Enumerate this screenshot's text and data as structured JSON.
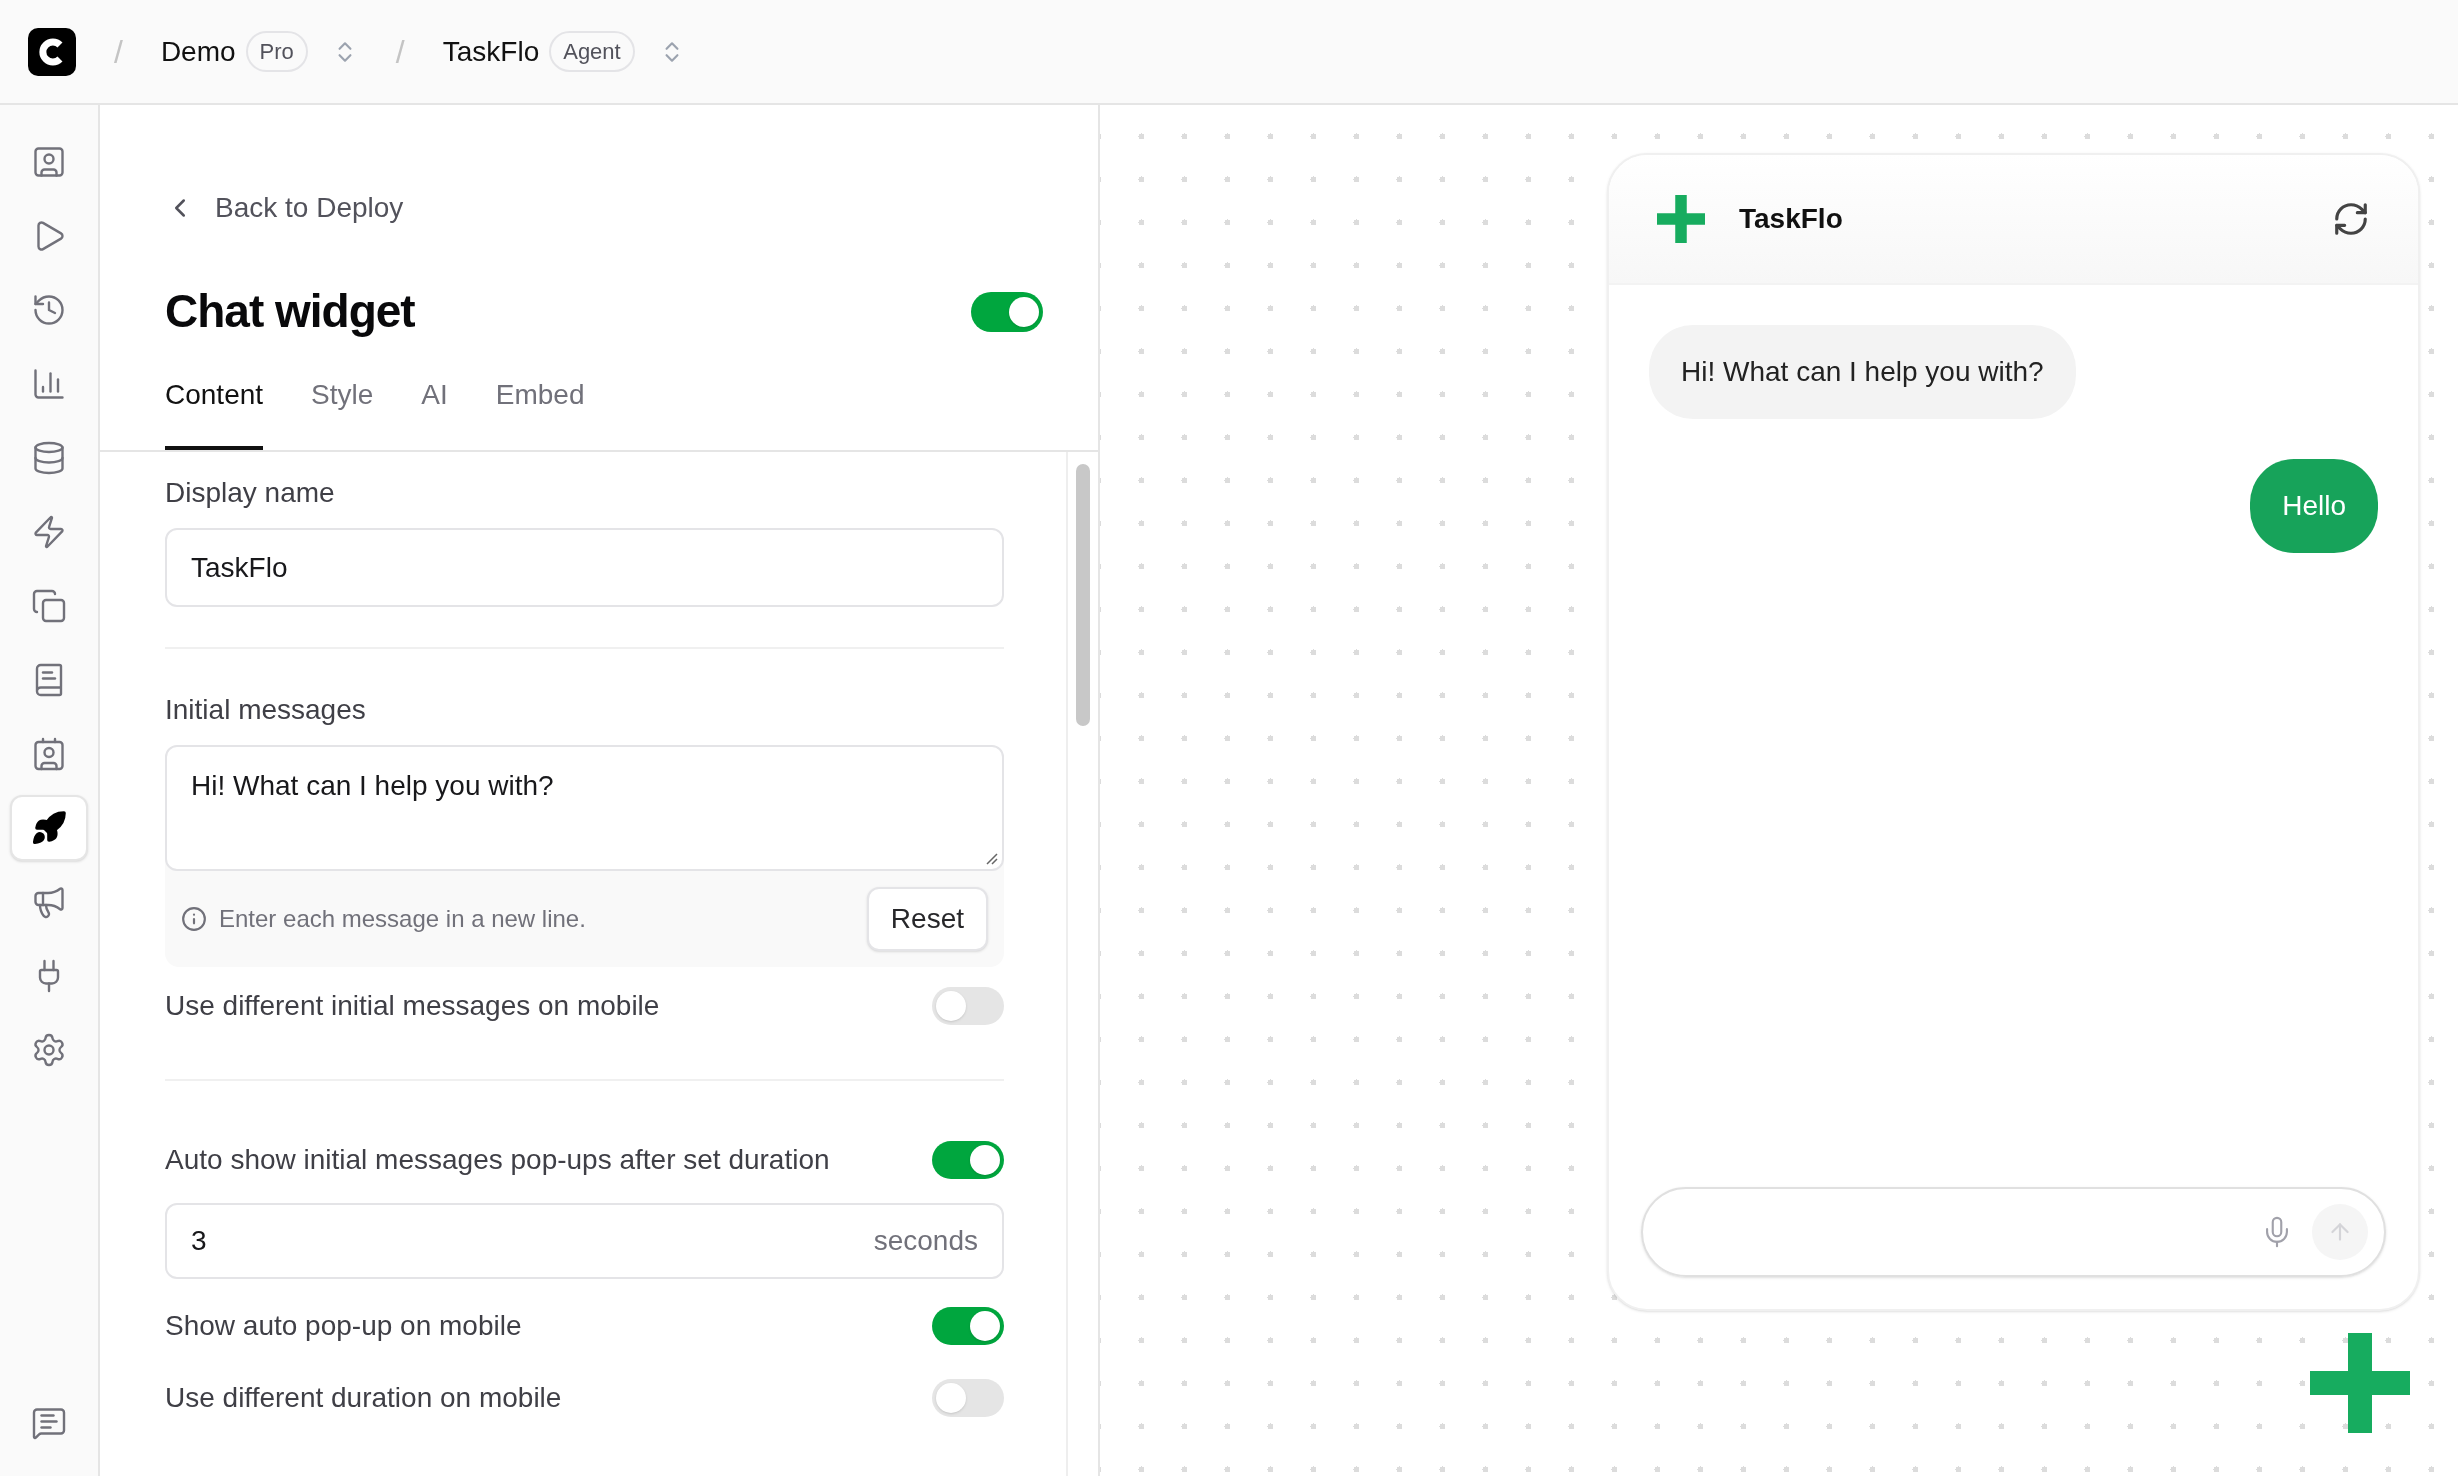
{
  "app_bar": {
    "breadcrumbs": [
      {
        "separator": "/",
        "name": "Demo",
        "badge": "Pro"
      },
      {
        "separator": "/",
        "name": "TaskFlo",
        "badge": "Agent"
      }
    ]
  },
  "sidebar": {
    "items": [
      {
        "kind": "persona",
        "selected": false
      },
      {
        "kind": "play",
        "selected": false
      },
      {
        "kind": "history",
        "selected": false
      },
      {
        "kind": "analytics",
        "selected": false
      },
      {
        "kind": "database",
        "selected": false
      },
      {
        "kind": "actions",
        "selected": false
      },
      {
        "kind": "copies",
        "selected": false
      },
      {
        "kind": "book",
        "selected": false
      },
      {
        "kind": "contact",
        "selected": false
      },
      {
        "kind": "deploy",
        "selected": true
      },
      {
        "kind": "megaphone",
        "selected": false
      },
      {
        "kind": "plug",
        "selected": false
      },
      {
        "kind": "settings",
        "selected": false
      }
    ],
    "bottom_item": {
      "kind": "chat"
    }
  },
  "settings_panel": {
    "back_link": "Back to Deploy",
    "title": "Chat widget",
    "enabled": true,
    "tabs": [
      {
        "label": "Content",
        "selected": true
      },
      {
        "label": "Style",
        "selected": false
      },
      {
        "label": "AI",
        "selected": false
      },
      {
        "label": "Embed",
        "selected": false
      }
    ],
    "fields": [
      {
        "kind": "text",
        "label": "Display name",
        "value": "TaskFlo"
      },
      {
        "kind": "divider"
      },
      {
        "kind": "textarea",
        "label": "Initial messages",
        "value": "Hi! What can I help you with?",
        "hint": "Enter each message in a new line.",
        "button": "Reset"
      },
      {
        "kind": "toggle",
        "label": "Use different initial messages on mobile",
        "on": false
      },
      {
        "kind": "divider"
      },
      {
        "kind": "toggle",
        "label": "Auto show initial messages pop-ups after set duration",
        "on": true
      },
      {
        "kind": "number",
        "value": "3",
        "unit": "seconds"
      },
      {
        "kind": "toggle",
        "label": "Show auto pop-up on mobile",
        "on": true
      },
      {
        "kind": "toggle",
        "label": "Use different duration on mobile",
        "on": false
      }
    ]
  },
  "preview": {
    "chat": {
      "title": "TaskFlo",
      "messages": [
        {
          "kind": "bot",
          "text": "Hi! What can I help you with?"
        },
        {
          "kind": "user",
          "text": "Hello"
        }
      ]
    }
  }
}
